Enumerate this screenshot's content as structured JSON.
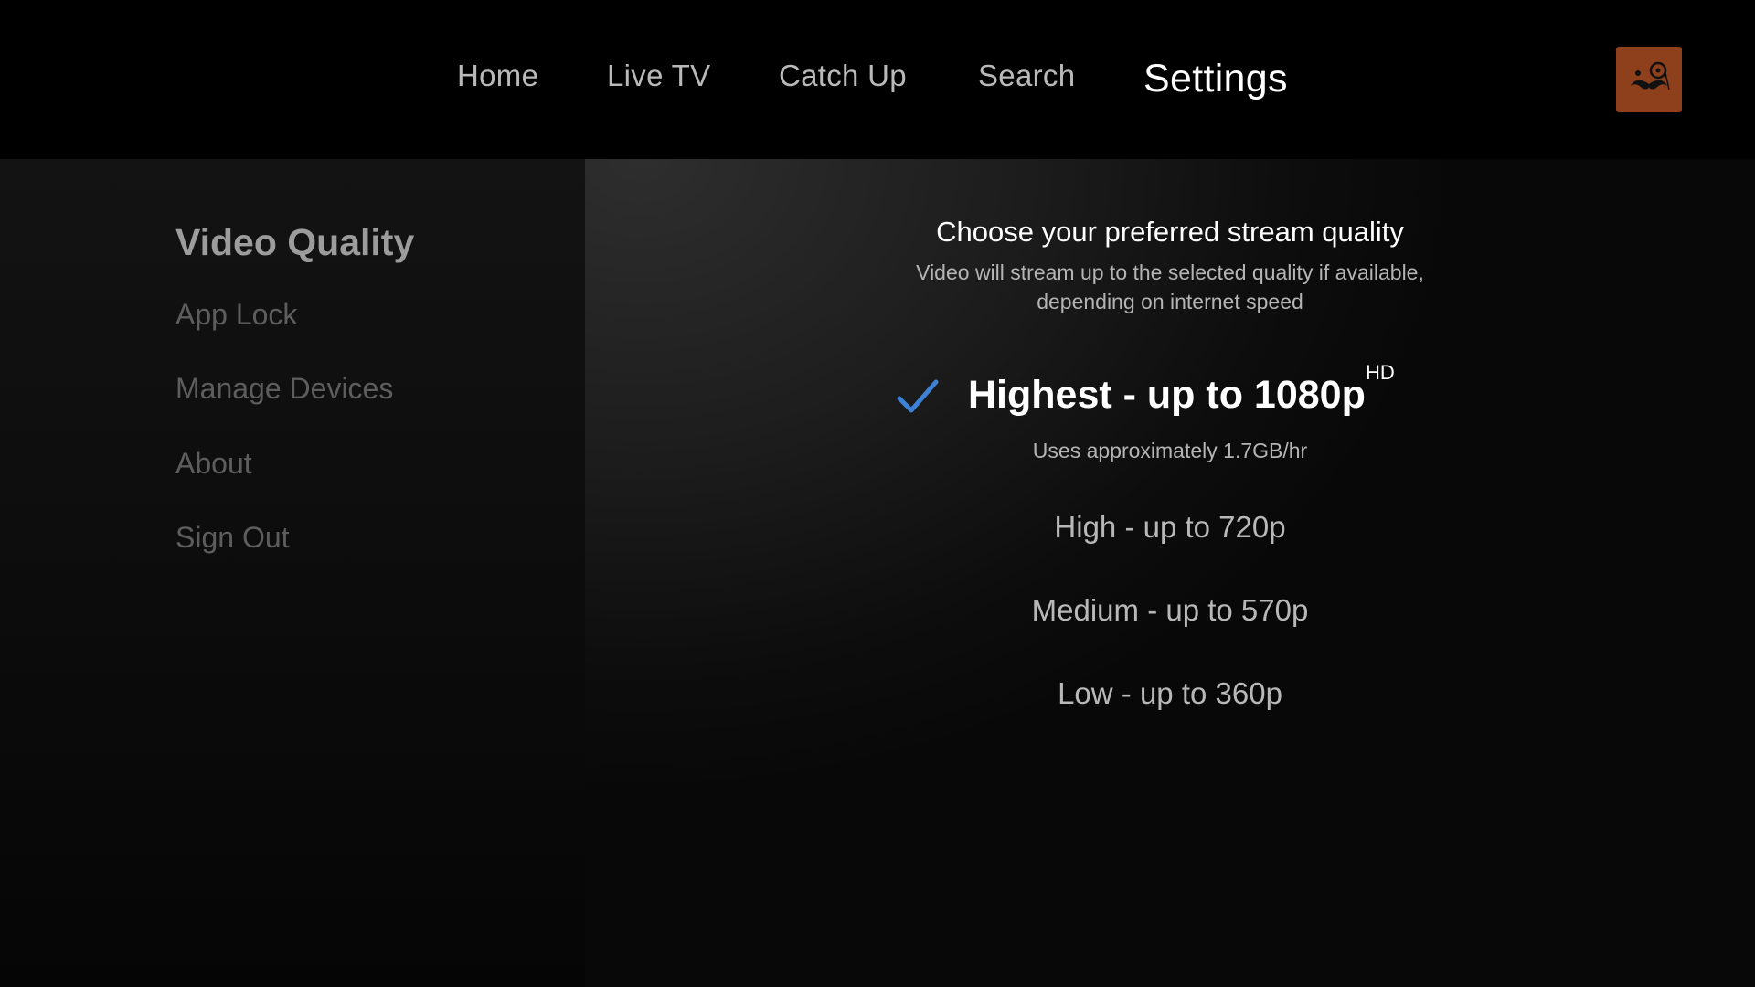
{
  "nav": {
    "items": [
      {
        "label": "Home"
      },
      {
        "label": "Live TV"
      },
      {
        "label": "Catch Up"
      },
      {
        "label": "Search"
      },
      {
        "label": "Settings",
        "active": true
      }
    ]
  },
  "avatar": {
    "icon": "mustache-monocle-icon",
    "bg": "#8e3f1c"
  },
  "sidebar": {
    "items": [
      {
        "label": "Video Quality",
        "active": true
      },
      {
        "label": "App Lock"
      },
      {
        "label": "Manage Devices"
      },
      {
        "label": "About"
      },
      {
        "label": "Sign Out"
      }
    ]
  },
  "main": {
    "title": "Choose your preferred stream quality",
    "subtitle_line1": "Video will stream up to the selected quality if available,",
    "subtitle_line2": "depending on internet speed",
    "options": [
      {
        "label": "Highest - up to 1080p",
        "badge": "HD",
        "note": "Uses approximately 1.7GB/hr",
        "selected": true
      },
      {
        "label": "High - up to 720p"
      },
      {
        "label": "Medium - up to 570p"
      },
      {
        "label": "Low - up to 360p"
      }
    ],
    "check_color": "#3e82d6"
  }
}
